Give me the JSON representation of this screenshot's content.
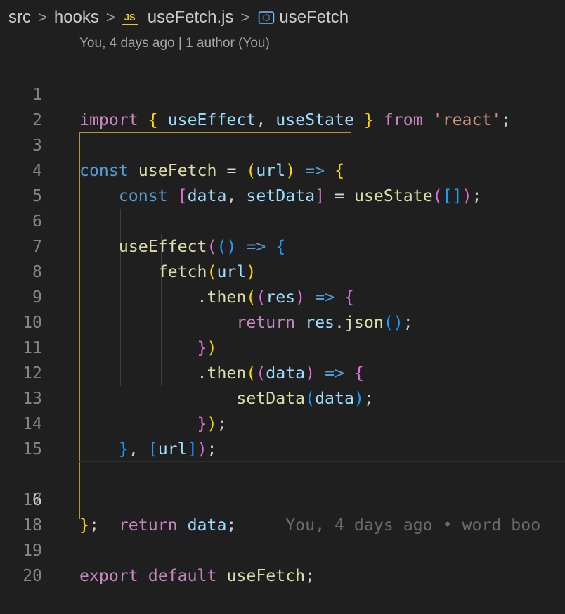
{
  "breadcrumb": {
    "parts": [
      "src",
      "hooks",
      "useFetch.js",
      "useFetch"
    ],
    "separator": ">",
    "file_icon": "JS",
    "symbol_icon": "symbol-method-icon"
  },
  "blame_header": "You, 4 days ago | 1 author (You)",
  "inline_blame": "You, 4 days ago • word boo",
  "active_line": 16,
  "line_numbers": [
    "1",
    "2",
    "3",
    "4",
    "5",
    "6",
    "7",
    "8",
    "9",
    "10",
    "11",
    "12",
    "13",
    "14",
    "15",
    "16",
    "17",
    "18",
    "19",
    "20"
  ],
  "tokens": {
    "import": "import",
    "useEffect": "useEffect",
    "useState": "useState",
    "from": "from",
    "react_str": "'react'",
    "const": "const",
    "useFetch": "useFetch",
    "url": "url",
    "data": "data",
    "setData": "setData",
    "fetch": "fetch",
    "then": "then",
    "res": "res",
    "return": "return",
    "json": "json",
    "export": "export",
    "default": "default"
  },
  "colors": {
    "background": "#1f1f1f",
    "keyword_control": "#c586c0",
    "keyword_storage": "#569cd6",
    "function": "#dcdcaa",
    "variable": "#9cdcfe",
    "string": "#ce9178",
    "bracket_1": "#ffd700",
    "bracket_2": "#da70d6",
    "bracket_3": "#179fff",
    "scope_highlight": "#b39a25"
  }
}
